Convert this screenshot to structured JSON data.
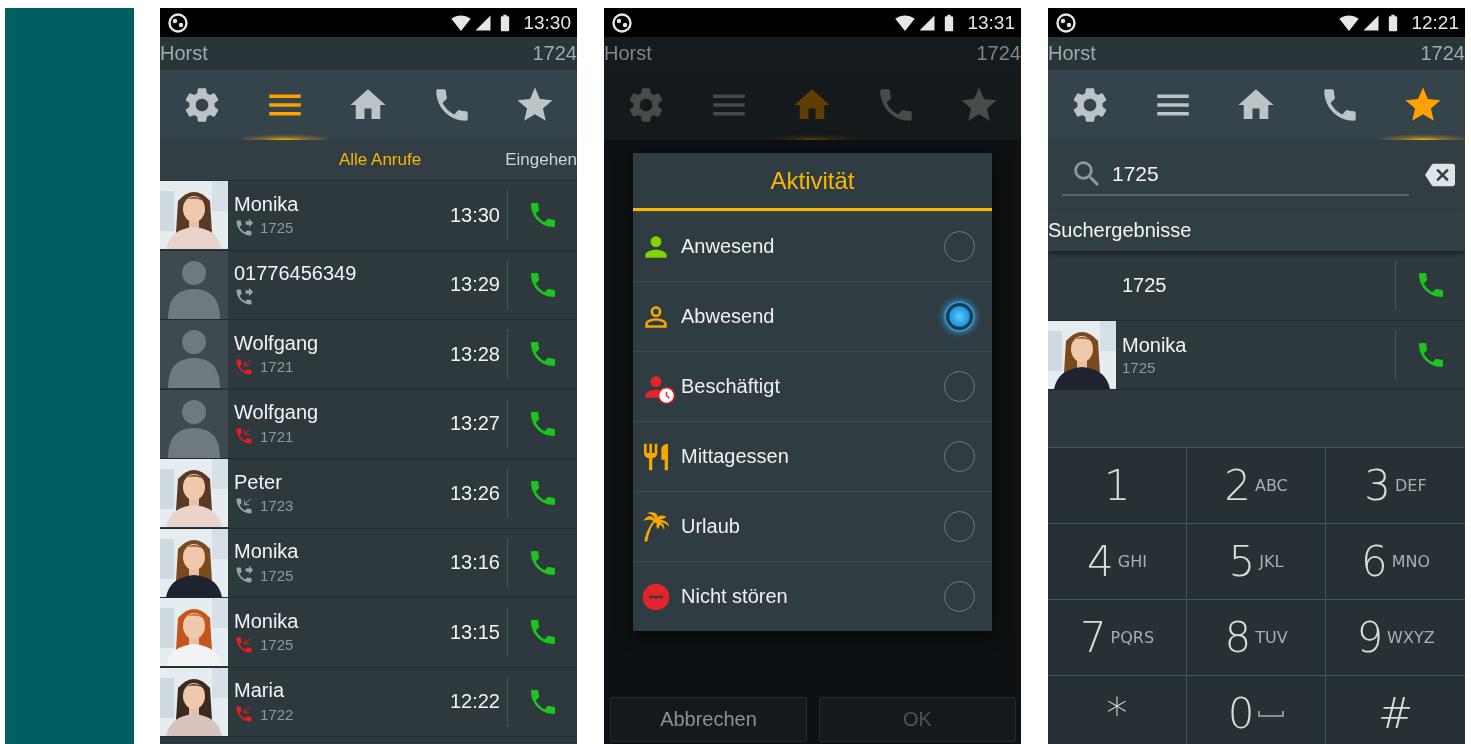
{
  "phones": [
    {
      "kind": "call_log",
      "status_bar": {
        "time": "13:30"
      },
      "header": {
        "name": "Horst",
        "extension": "1724"
      },
      "nav": [
        {
          "kind": "settings",
          "selected": false
        },
        {
          "kind": "list",
          "selected": true
        },
        {
          "kind": "home",
          "selected": false
        },
        {
          "kind": "phone",
          "selected": false
        },
        {
          "kind": "favorites",
          "selected": false
        }
      ],
      "tabs": [
        {
          "label": "Alle Anrufe",
          "selected": true
        },
        {
          "label": "Eingehen",
          "selected": false
        }
      ],
      "calls": [
        {
          "name": "Monika",
          "direction": {
            "kind": "outgoing"
          },
          "number": "1725",
          "time": "13:30"
        },
        {
          "avatar": {
            "kind": "silhouette"
          },
          "name": "01776456349",
          "direction": {
            "kind": "outgoing"
          },
          "time": "13:29"
        },
        {
          "avatar": {
            "kind": "silhouette"
          },
          "name": "Wolfgang",
          "direction": {
            "kind": "missed"
          },
          "number": "1721",
          "time": "13:28"
        },
        {
          "avatar": {
            "kind": "silhouette"
          },
          "name": "Wolfgang",
          "direction": {
            "kind": "missed"
          },
          "number": "1721",
          "time": "13:27"
        },
        {
          "name": "Peter",
          "direction": {
            "kind": "incoming"
          },
          "number": "1723",
          "time": "13:26"
        },
        {
          "name": "Monika",
          "direction": {
            "kind": "outgoing"
          },
          "number": "1725",
          "time": "13:16"
        },
        {
          "name": "Monika",
          "direction": {
            "kind": "missed"
          },
          "number": "1725",
          "time": "13:15"
        },
        {
          "name": "Maria",
          "direction": {
            "kind": "missed"
          },
          "number": "1722",
          "time": "12:22"
        }
      ]
    },
    {
      "kind": "activity_dialog",
      "status_bar": {
        "time": "13:31"
      },
      "header": {
        "name": "Horst",
        "extension": "1724"
      },
      "nav": [
        {
          "kind": "settings",
          "selected": false
        },
        {
          "kind": "list",
          "selected": false
        },
        {
          "kind": "home",
          "selected": true
        },
        {
          "kind": "phone",
          "selected": false
        },
        {
          "kind": "favorites",
          "selected": false
        }
      ],
      "dialog": {
        "title": "Aktivität",
        "options": [
          {
            "kind": "present",
            "label": "Anwesend",
            "selected": false
          },
          {
            "kind": "absent",
            "label": "Abwesend",
            "selected": true
          },
          {
            "kind": "busy",
            "label": "Beschäftigt",
            "selected": false
          },
          {
            "kind": "lunch",
            "label": "Mittagessen",
            "selected": false
          },
          {
            "kind": "vacation",
            "label": "Urlaub",
            "selected": false
          },
          {
            "kind": "dnd",
            "label": "Nicht stören",
            "selected": false
          }
        ]
      },
      "buttons": [
        {
          "label": "Abbrechen",
          "disabled": false
        },
        {
          "label": "OK",
          "disabled": true
        }
      ]
    },
    {
      "kind": "search",
      "status_bar": {
        "time": "12:21"
      },
      "header": {
        "name": "Horst",
        "extension": "1724"
      },
      "nav": [
        {
          "kind": "settings",
          "selected": false
        },
        {
          "kind": "list",
          "selected": false
        },
        {
          "kind": "home",
          "selected": false
        },
        {
          "kind": "phone",
          "selected": false
        },
        {
          "kind": "favorites",
          "selected": true
        }
      ],
      "search": {
        "value": "1725"
      },
      "results_title": "Suchergebnisse",
      "results": [
        {
          "name": "1725"
        },
        {
          "name": "Monika",
          "number": "1725"
        }
      ],
      "keypad": [
        {
          "kind": "plain",
          "digit": "1"
        },
        {
          "kind": "plain",
          "digit": "2",
          "letters": "ABC"
        },
        {
          "kind": "plain",
          "digit": "3",
          "letters": "DEF"
        },
        {
          "kind": "plain",
          "digit": "4",
          "letters": "GHI"
        },
        {
          "kind": "plain",
          "digit": "5",
          "letters": "JKL"
        },
        {
          "kind": "plain",
          "digit": "6",
          "letters": "MNO"
        },
        {
          "kind": "plain",
          "digit": "7",
          "letters": "PQRS"
        },
        {
          "kind": "plain",
          "digit": "8",
          "letters": "TUV"
        },
        {
          "kind": "plain",
          "digit": "9",
          "letters": "WXYZ"
        },
        {
          "kind": "plain",
          "digit": "*"
        },
        {
          "kind": "space",
          "digit": "0"
        },
        {
          "kind": "plain",
          "digit": "#"
        }
      ]
    }
  ]
}
